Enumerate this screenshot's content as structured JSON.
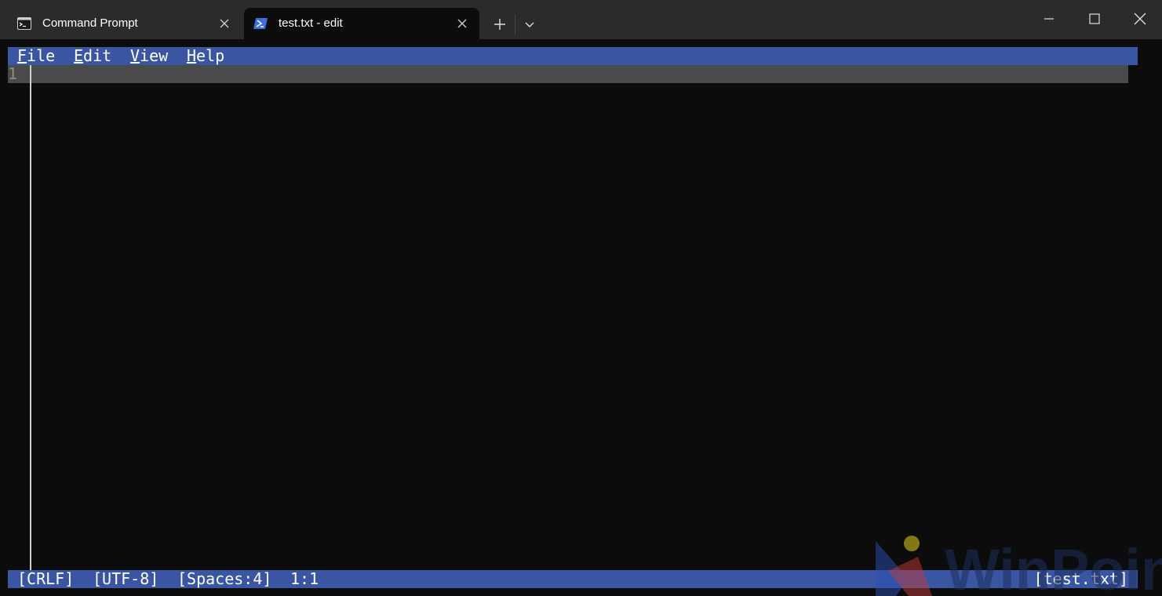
{
  "tabs": [
    {
      "label": "Command Prompt",
      "icon": "cmd-icon",
      "active": false
    },
    {
      "label": "test.txt - edit",
      "icon": "powershell-icon",
      "active": true
    }
  ],
  "menu": {
    "file": {
      "accel": "F",
      "rest": "ile"
    },
    "edit": {
      "accel": "E",
      "rest": "dit"
    },
    "view": {
      "accel": "V",
      "rest": "iew"
    },
    "help": {
      "accel": "H",
      "rest": "elp"
    }
  },
  "editor": {
    "line_number": "1",
    "content": ""
  },
  "status": {
    "eol": "[CRLF]",
    "encoding": "[UTF-8]",
    "indent": "[Spaces:4]",
    "position": "1:1",
    "filename": "[test.txt]"
  },
  "watermark": {
    "text": "WinPoin"
  },
  "colors": {
    "titlebar": "#2b2b2b",
    "terminal_bg": "#0c0c0c",
    "menubar_bg": "#3a56a3",
    "statusbar_bg": "#3a56a3",
    "current_line": "#4a4a4a",
    "powershell_blue": "#3b6ee0"
  }
}
